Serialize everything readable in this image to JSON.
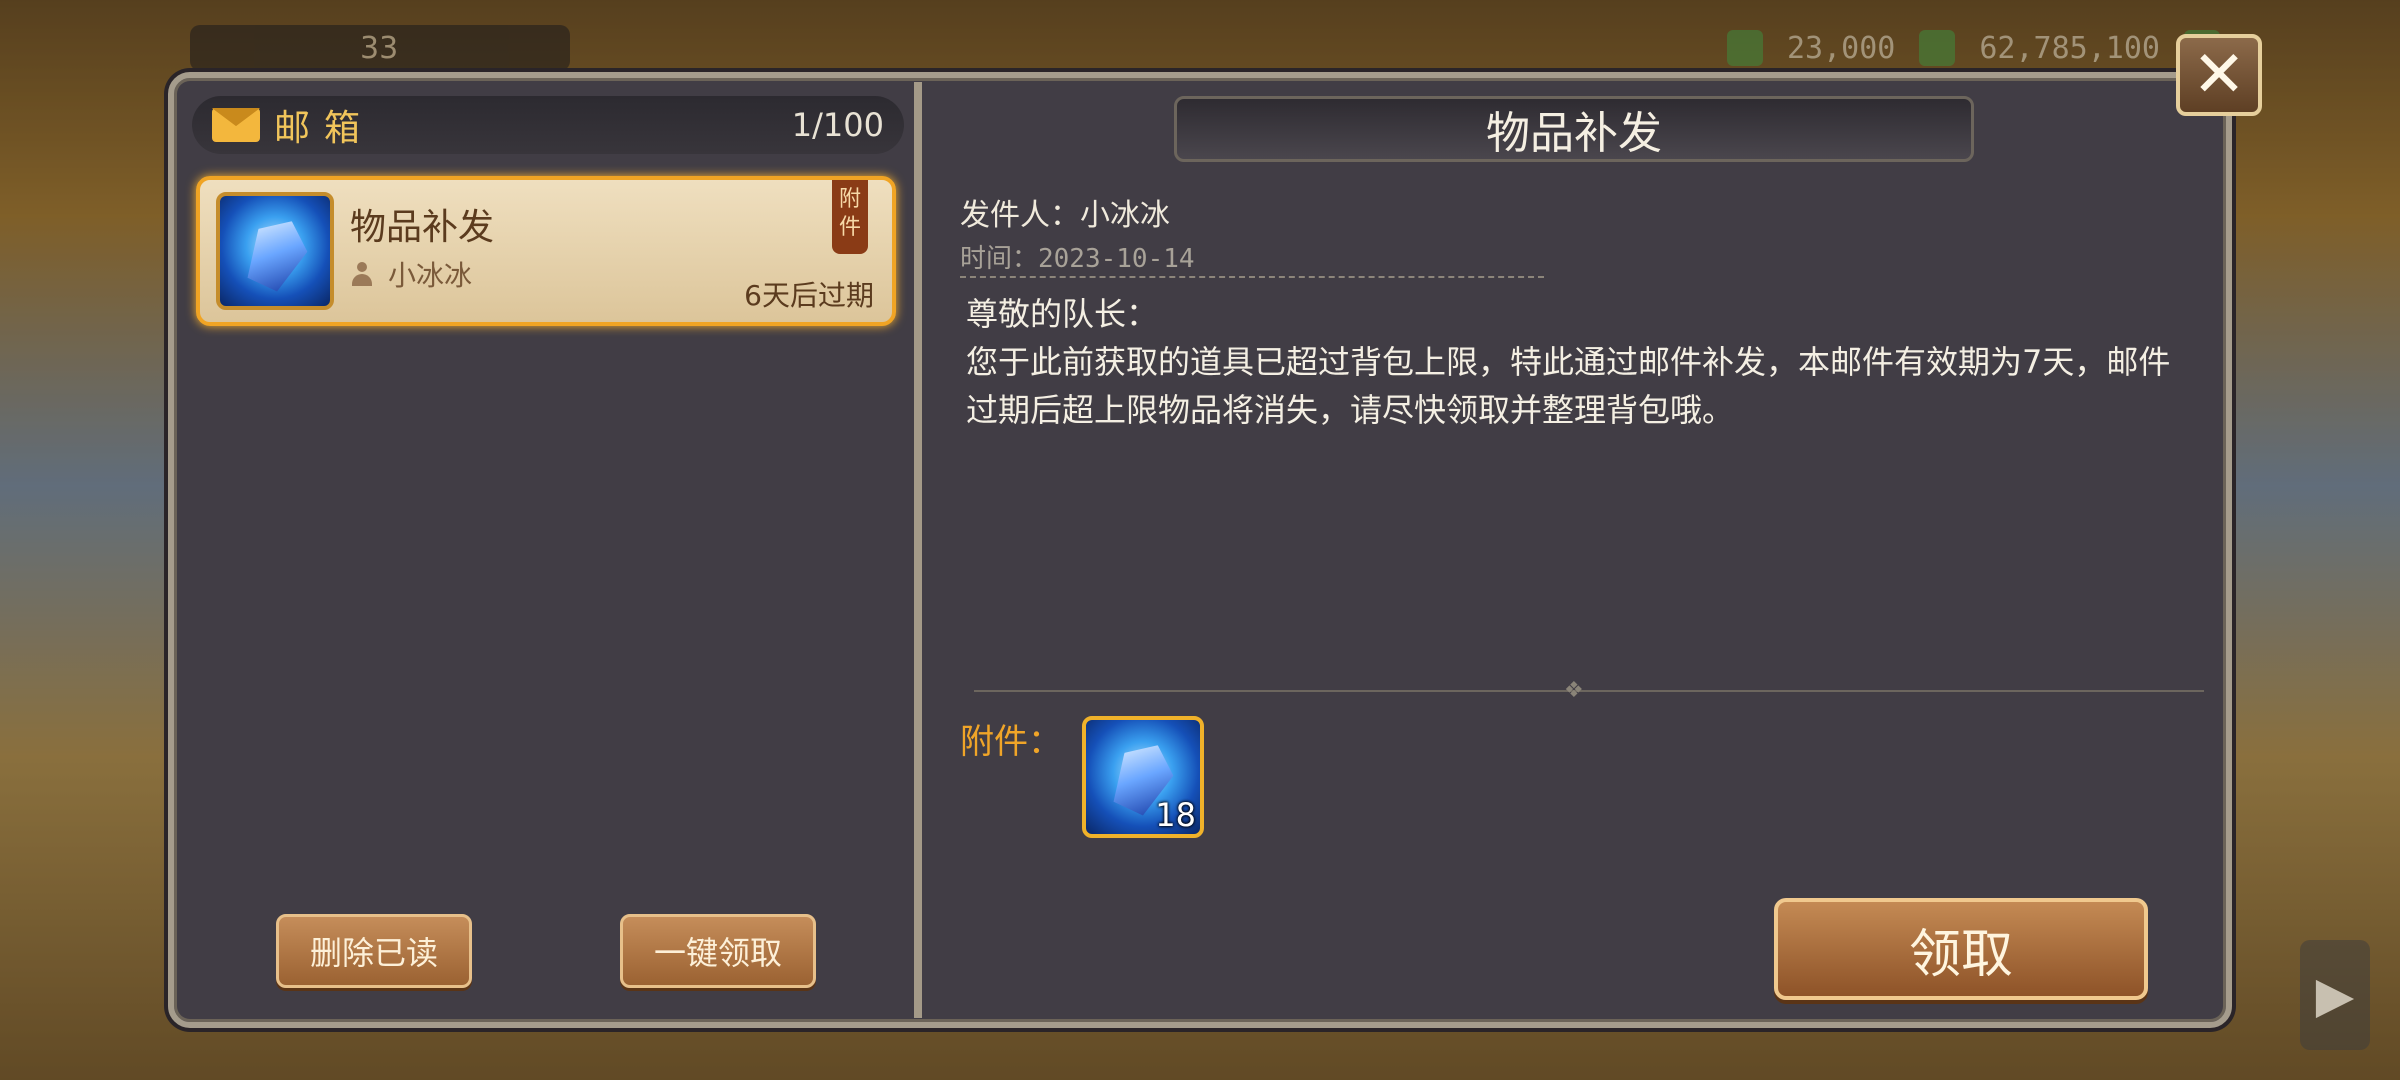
{
  "topbar": {
    "level": "33",
    "diamonds": "23,000",
    "gold": "62,785,100"
  },
  "mailbox": {
    "title": "邮箱",
    "count": "1/100",
    "items": [
      {
        "name": "物品补发",
        "sender": "小冰冰",
        "expire": "6天后过期",
        "tag": "附件",
        "icon": "blue-crystal-icon"
      }
    ],
    "delete_read_label": "删除已读",
    "claim_all_label": "一键领取"
  },
  "detail": {
    "title": "物品补发",
    "sender": "发件人：小冰冰",
    "time": "时间：2023-10-14",
    "body": "尊敬的队长：\n您于此前获取的道具已超过背包上限，特此通过邮件补发，本邮件有效期为7天，邮件过期后超上限物品将消失，请尽快领取并整理背包哦。",
    "attachments_label": "附件：",
    "attachments": [
      {
        "icon": "blue-crystal-icon",
        "quantity": "18"
      }
    ],
    "claim_label": "领取"
  },
  "colors": {
    "accent_gold": "#f0a528",
    "panel_bg": "#413d45",
    "button_brown": "#9b6232"
  }
}
